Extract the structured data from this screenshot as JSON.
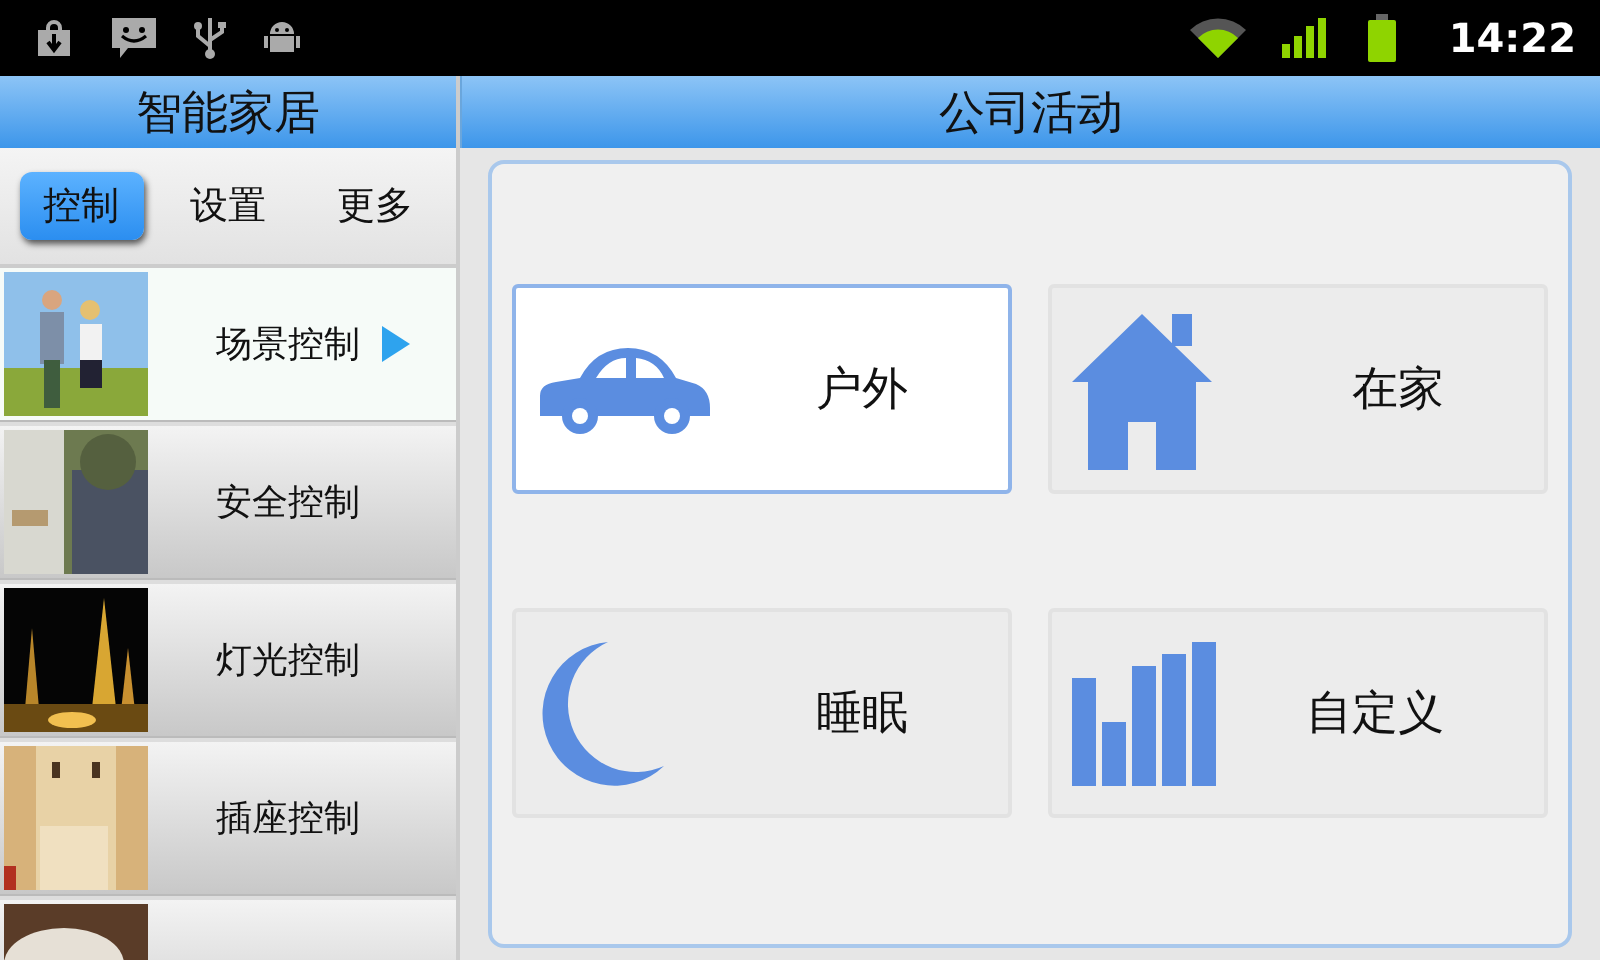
{
  "status_bar": {
    "time": "14:22"
  },
  "sidebar": {
    "title": "智能家居",
    "tabs": [
      {
        "label": "控制",
        "selected": true
      },
      {
        "label": "设置",
        "selected": false
      },
      {
        "label": "更多",
        "selected": false
      }
    ],
    "items": [
      {
        "label": "场景控制",
        "selected": true
      },
      {
        "label": "安全控制",
        "selected": false
      },
      {
        "label": "灯光控制",
        "selected": false
      },
      {
        "label": "插座控制",
        "selected": false
      },
      {
        "selected": false
      }
    ]
  },
  "main": {
    "title": "公司活动",
    "tiles": [
      {
        "kind": "car",
        "label": "户外",
        "selected": true
      },
      {
        "kind": "house",
        "label": "在家",
        "selected": false
      },
      {
        "kind": "moon",
        "label": "睡眠",
        "selected": false
      },
      {
        "kind": "bars",
        "label": "自定义",
        "selected": false
      }
    ]
  }
}
